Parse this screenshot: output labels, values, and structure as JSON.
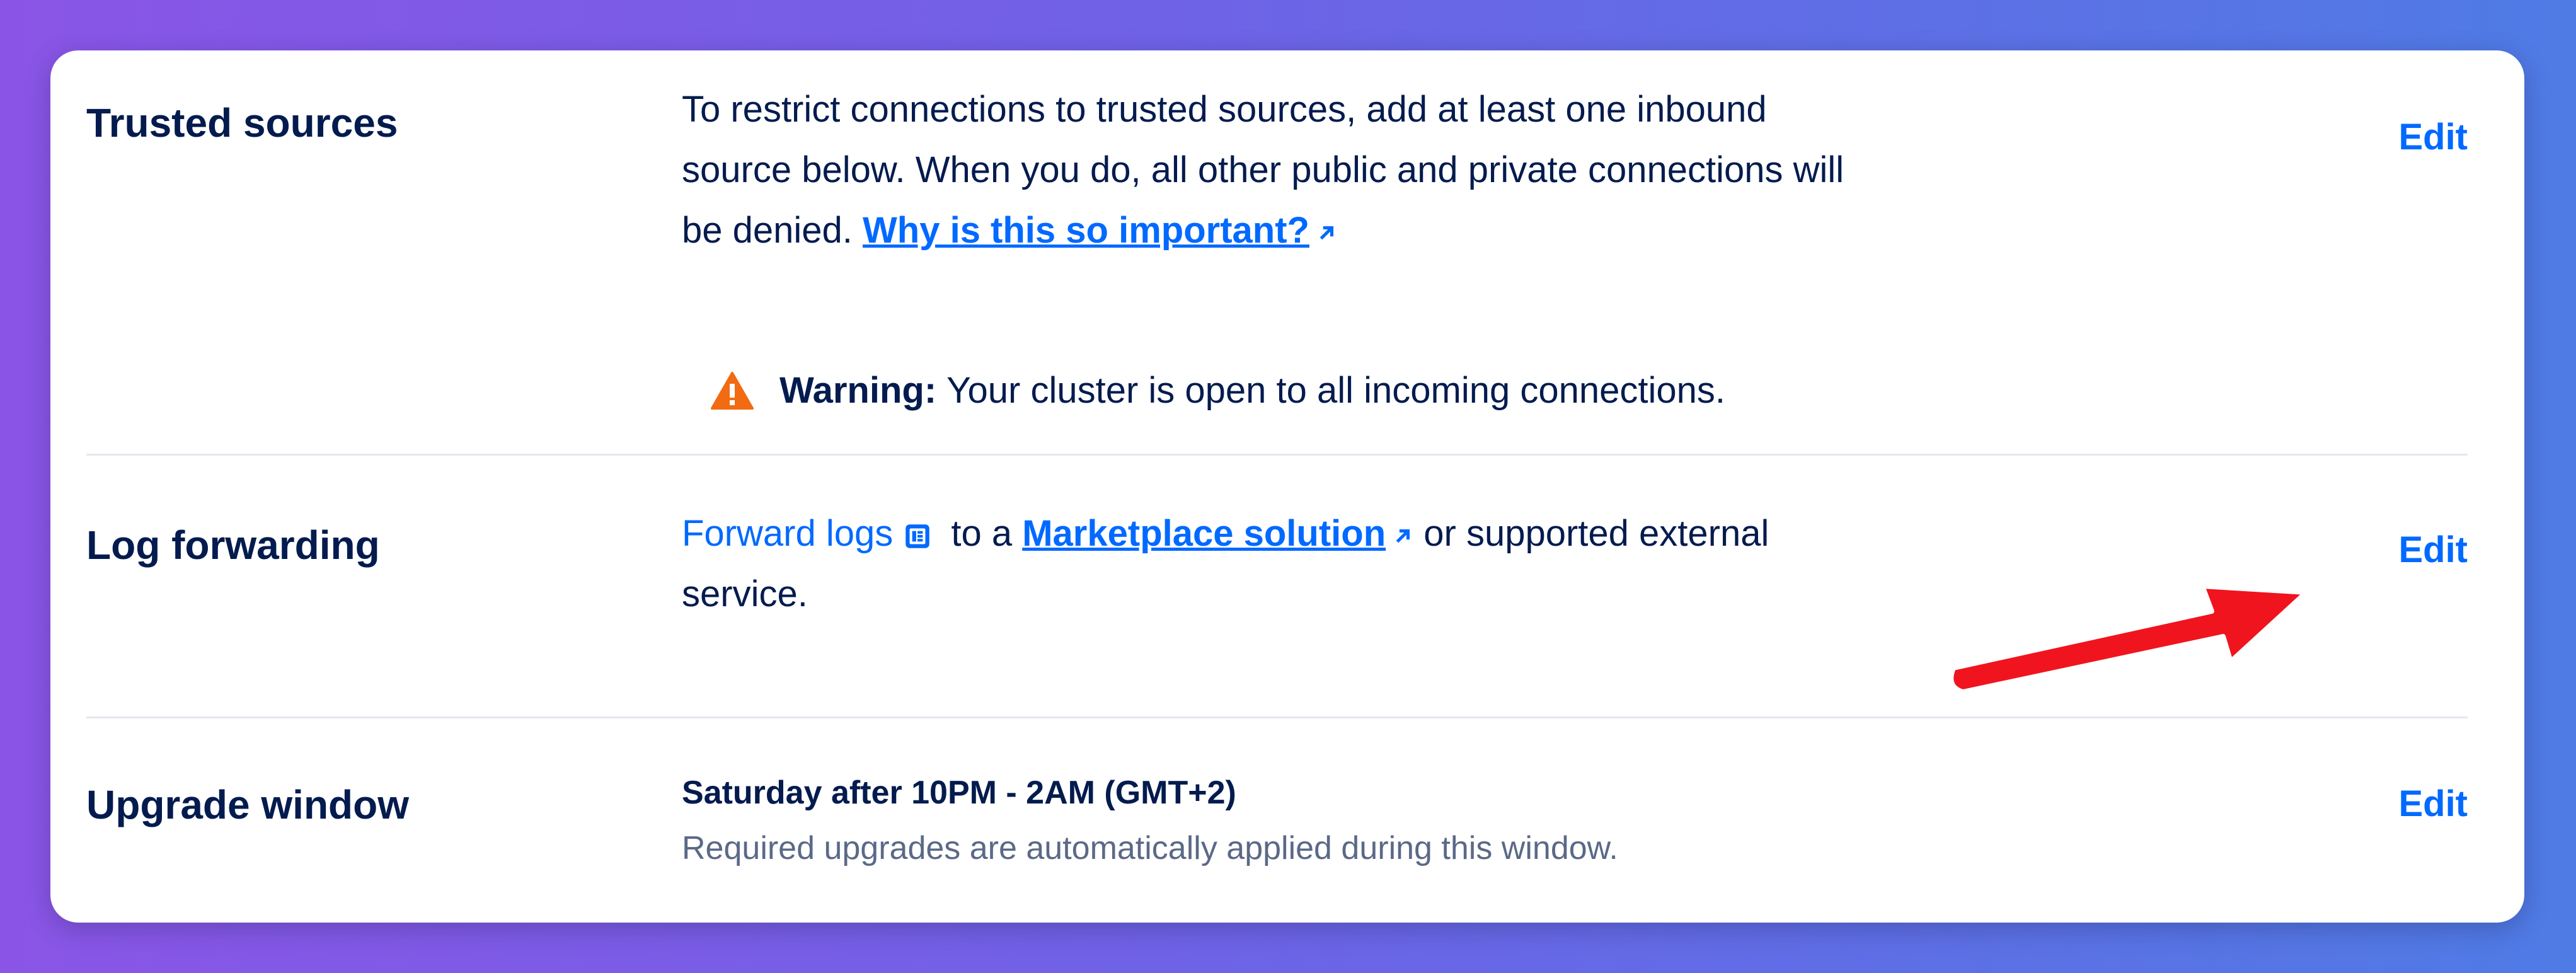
{
  "sections": {
    "trusted_sources": {
      "title": "Trusted sources",
      "text_before_link": "To restrict connections to trusted sources, add at least one inbound source below. When you do, all other public and private connections will be denied. ",
      "link_text": "Why is this so important?",
      "link_icon": "external-link-icon",
      "warning_label": "Warning:",
      "warning_text": "Your cluster is open to all incoming connections.",
      "warning_icon": "warning-triangle-icon",
      "edit_label": "Edit"
    },
    "log_forwarding": {
      "title": "Log forwarding",
      "forward_logs_text": "Forward logs",
      "doc_icon": "document-icon",
      "middle_text": " to a ",
      "link_text": "Marketplace solution",
      "link_icon": "external-link-icon",
      "after_link_text": " or supported external service.",
      "edit_label": "Edit"
    },
    "upgrade_window": {
      "title": "Upgrade window",
      "schedule": "Saturday after 10PM - 2AM (GMT+2)",
      "description": "Required upgrades are automatically applied during this window.",
      "edit_label": "Edit"
    }
  },
  "colors": {
    "accent": "#0069ff",
    "heading": "#031b4e",
    "muted": "#5b6987",
    "warning": "#f26b12",
    "annotation_arrow": "#f0141e"
  }
}
